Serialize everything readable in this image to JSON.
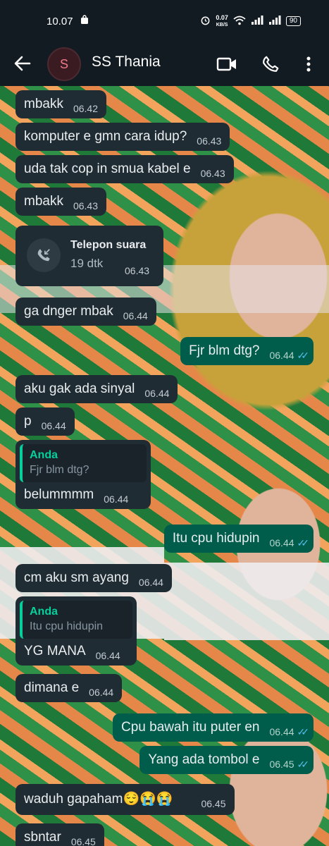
{
  "status_bar": {
    "time": "10.07",
    "net_speed": "0.07",
    "net_unit": "KB/S",
    "battery": "90"
  },
  "header": {
    "avatar_letter": "S",
    "contact_name": "SS Thania"
  },
  "colors": {
    "incoming_bubble": "#202c33",
    "outgoing_bubble": "#005c4b",
    "accent_green": "#06cf9c",
    "read_ticks": "#53bdeb"
  },
  "messages": [
    {
      "text": "mbakk",
      "time": "06.42"
    },
    {
      "text": "komputer e gmn cara idup?",
      "time": "06.43"
    },
    {
      "text": "uda tak cop in smua kabel e",
      "time": "06.43"
    },
    {
      "text": "mbakk",
      "time": "06.43"
    },
    {
      "call_title": "Telepon suara",
      "call_duration": "19 dtk",
      "time": "06.43"
    },
    {
      "text": "ga dnger mbak",
      "time": "06.44"
    },
    {
      "text": "Fjr blm dtg?",
      "time": "06.44"
    },
    {
      "text": "aku gak ada sinyal",
      "time": "06.44"
    },
    {
      "text": "p",
      "time": "06.44"
    },
    {
      "quote_author": "Anda",
      "quote_text": "Fjr blm dtg?",
      "text": "belummmm",
      "time": "06.44"
    },
    {
      "text": "Itu cpu hidupin",
      "time": "06.44"
    },
    {
      "text": "cm aku sm ayang",
      "time": "06.44"
    },
    {
      "quote_author": "Anda",
      "quote_text": "Itu cpu hidupin",
      "text": "YG MANA",
      "time": "06.44"
    },
    {
      "text": "dimana e",
      "time": "06.44"
    },
    {
      "text": "Cpu bawah itu puter en",
      "time": "06.44"
    },
    {
      "text": "Yang ada tombol e",
      "time": "06.45"
    },
    {
      "text": "waduh gapaham😌😭😭",
      "time": "06.45"
    },
    {
      "text": "sbntar",
      "time": "06.45"
    }
  ]
}
